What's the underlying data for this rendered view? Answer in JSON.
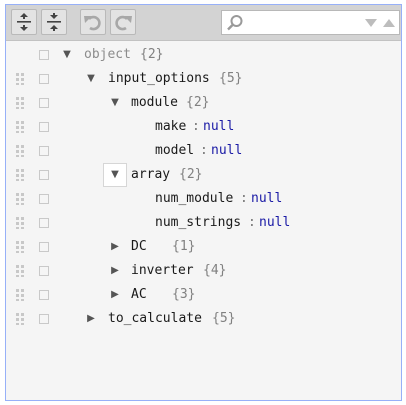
{
  "colors": {
    "menu_bg": "#d3d3d3",
    "border": "#97b0f8",
    "null_value": "#1a1aa6",
    "count": "#808080"
  },
  "toolbar": {
    "buttons": [
      {
        "name": "expand-all-button",
        "icon": "expand-all-icon"
      },
      {
        "name": "collapse-all-button",
        "icon": "collapse-all-icon"
      },
      {
        "name": "undo-button",
        "icon": "undo-icon"
      },
      {
        "name": "redo-button",
        "icon": "redo-icon"
      }
    ],
    "search": {
      "placeholder": "",
      "value": ""
    }
  },
  "tree": {
    "rows": [
      {
        "key": "object",
        "count": "{2}",
        "toggle": "expanded"
      },
      {
        "key": "input_options",
        "count": "{5}",
        "toggle": "expanded"
      },
      {
        "key": "module",
        "count": "{2}",
        "toggle": "expanded"
      },
      {
        "key": "make",
        "sep": ":",
        "value": "null"
      },
      {
        "key": "model",
        "sep": ":",
        "value": "null"
      },
      {
        "key": "array",
        "count": "{2}",
        "toggle": "expanded"
      },
      {
        "key": "num_module",
        "sep": ":",
        "value": "null"
      },
      {
        "key": "num_strings",
        "sep": ":",
        "value": "null"
      },
      {
        "key": "DC",
        "count": "{1}",
        "toggle": "collapsed"
      },
      {
        "key": "inverter",
        "count": "{4}",
        "toggle": "collapsed"
      },
      {
        "key": "AC",
        "count": "{3}",
        "toggle": "collapsed"
      },
      {
        "key": "to_calculate",
        "count": "{5}",
        "toggle": "collapsed"
      }
    ]
  }
}
